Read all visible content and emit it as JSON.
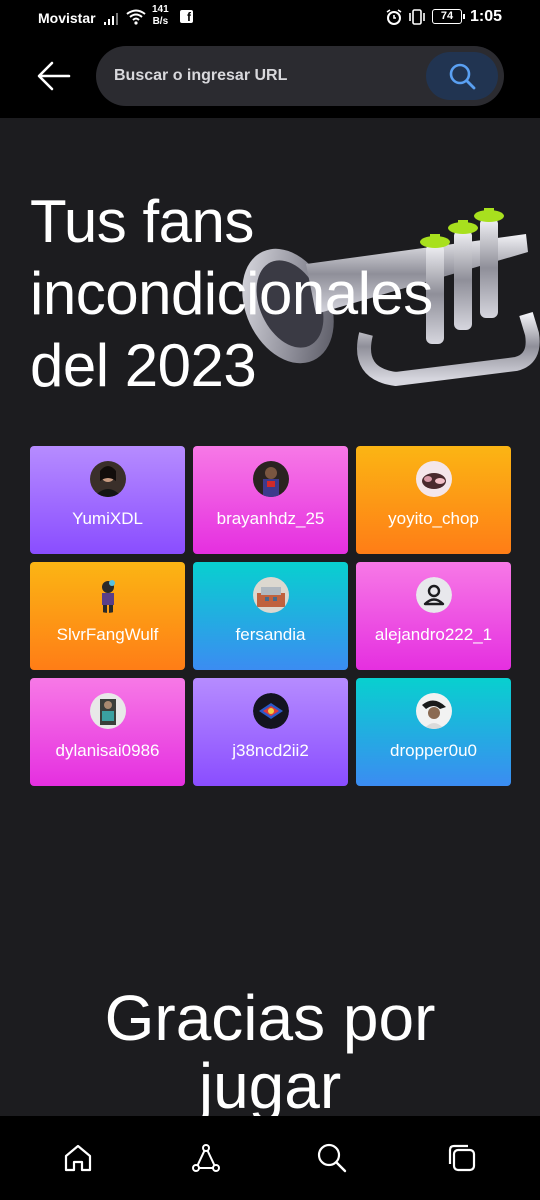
{
  "status_bar": {
    "carrier": "Movistar",
    "net_speed_value": "141",
    "net_speed_unit": "B/s",
    "battery": "74",
    "time": "1:05",
    "icons": [
      "signal-icon",
      "wifi-icon",
      "facebook-icon",
      "alarm-icon",
      "vibrate-icon",
      "battery-icon"
    ]
  },
  "app_bar": {
    "search_placeholder": "Buscar o ingresar URL",
    "search_value": "",
    "icons": [
      "back-arrow-icon",
      "search-icon"
    ],
    "colors": {
      "search_button": "#213451",
      "search_icon": "#5aa0f2"
    }
  },
  "main": {
    "headline": [
      "Tus fans",
      "incondicionales",
      "del 2023"
    ],
    "fans": [
      {
        "name": "YumiXDL",
        "gradient": "purple",
        "avatar": "photo"
      },
      {
        "name": "brayanhdz_25",
        "gradient": "pink",
        "avatar": "photo"
      },
      {
        "name": "yoyito_chop",
        "gradient": "orange",
        "avatar": "photo"
      },
      {
        "name": "SlvrFangWulf",
        "gradient": "orange",
        "avatar": "character"
      },
      {
        "name": "fersandia",
        "gradient": "teal",
        "avatar": "photo"
      },
      {
        "name": "alejandro222_1",
        "gradient": "pink",
        "avatar": "default-user"
      },
      {
        "name": "dylanisai0986",
        "gradient": "pink",
        "avatar": "photo"
      },
      {
        "name": "j38ncd2ii2",
        "gradient": "purple",
        "avatar": "logo"
      },
      {
        "name": "dropper0u0",
        "gradient": "teal",
        "avatar": "photo"
      }
    ],
    "thanks_lines": [
      "Gracias por",
      "jugar"
    ],
    "colors": {
      "purple": [
        "#b68cff",
        "#8a4dff"
      ],
      "pink": [
        "#f779e6",
        "#e52fe0"
      ],
      "orange": [
        "#fbb514",
        "#ff7d16"
      ],
      "teal": [
        "#08d0cf",
        "#3b8cf2"
      ],
      "trumpet_valve": "#a8e01e"
    }
  },
  "bottom_nav": {
    "items": [
      "home-icon",
      "share-icon",
      "search-icon",
      "tabs-icon"
    ]
  }
}
